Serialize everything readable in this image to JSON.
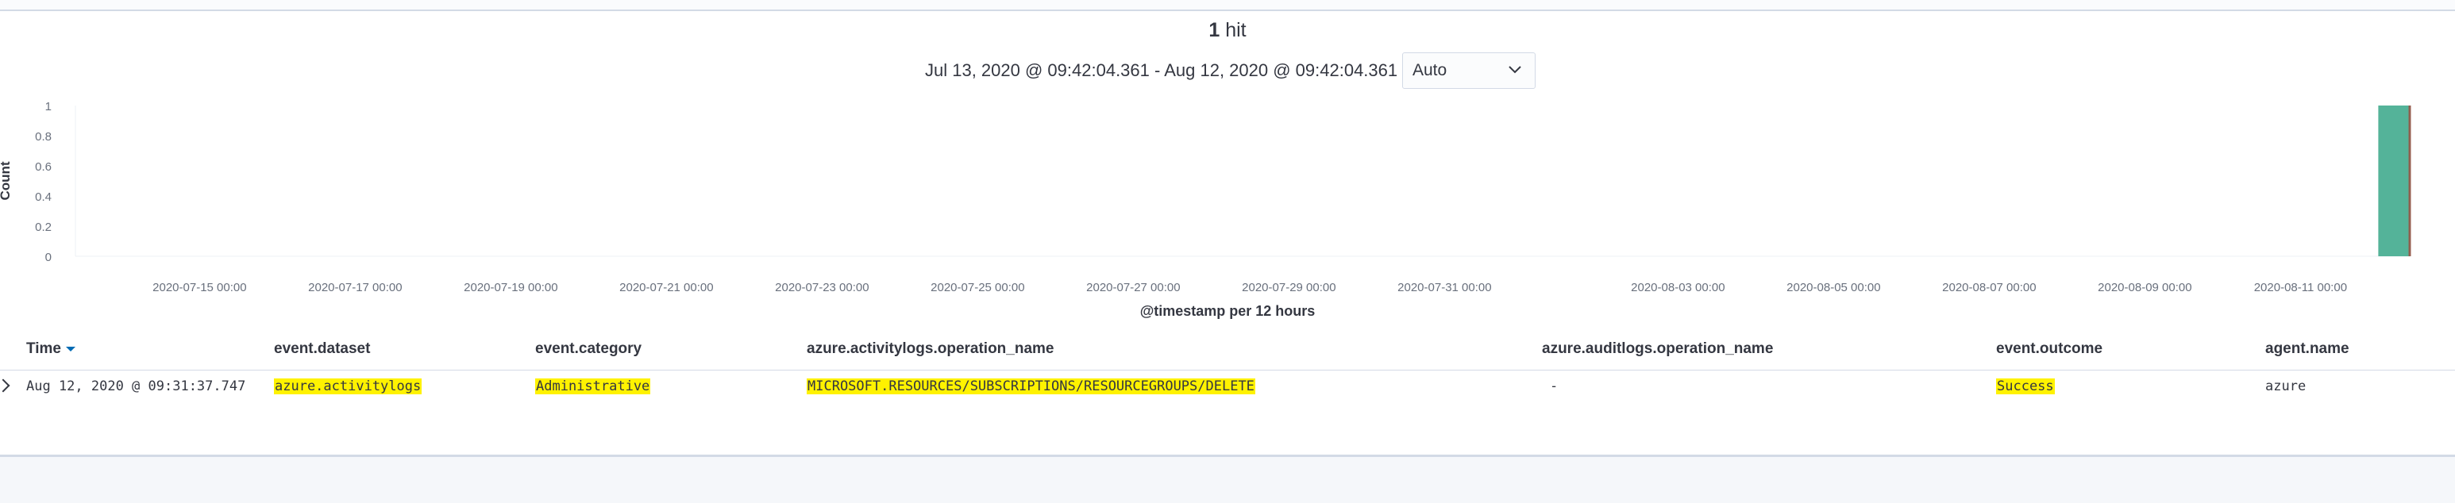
{
  "hits": {
    "count": "1",
    "label": "hit"
  },
  "time_range": {
    "range_text": "Jul 13, 2020 @ 09:42:04.361 - Aug 12, 2020 @ 09:42:04.361",
    "interval_value": "Auto"
  },
  "chart_data": {
    "type": "bar",
    "ylabel": "Count",
    "xlabel": "@timestamp per 12 hours",
    "ylim": [
      0,
      1
    ],
    "yticks": [
      "1",
      "0.8",
      "0.6",
      "0.4",
      "0.2",
      "0"
    ],
    "xticks": [
      "2020-07-15 00:00",
      "2020-07-17 00:00",
      "2020-07-19 00:00",
      "2020-07-21 00:00",
      "2020-07-23 00:00",
      "2020-07-25 00:00",
      "2020-07-27 00:00",
      "2020-07-29 00:00",
      "2020-07-31 00:00",
      "2020-08-03 00:00",
      "2020-08-05 00:00",
      "2020-08-07 00:00",
      "2020-08-09 00:00",
      "2020-08-11 00:00"
    ],
    "x_start": "2020-07-13 09:42:04",
    "x_end": "2020-08-12 09:42:04",
    "bars": [
      {
        "x": "2020-08-12 00:00",
        "value": 1
      }
    ],
    "current_time": "2020-08-12 09:42:04",
    "bar_color": "#54b399",
    "marker_color": "#bd271e"
  },
  "table": {
    "columns": [
      "Time",
      "event.dataset",
      "event.category",
      "azure.activitylogs.operation_name",
      "azure.auditlogs.operation_name",
      "event.outcome",
      "agent.name"
    ],
    "rows": [
      [
        "Aug 12, 2020 @ 09:31:37.747",
        "azure.activitylogs",
        "Administrative",
        "MICROSOFT.RESOURCES/SUBSCRIPTIONS/RESOURCEGROUPS/DELETE",
        "-",
        "Success",
        "azure"
      ]
    ]
  }
}
